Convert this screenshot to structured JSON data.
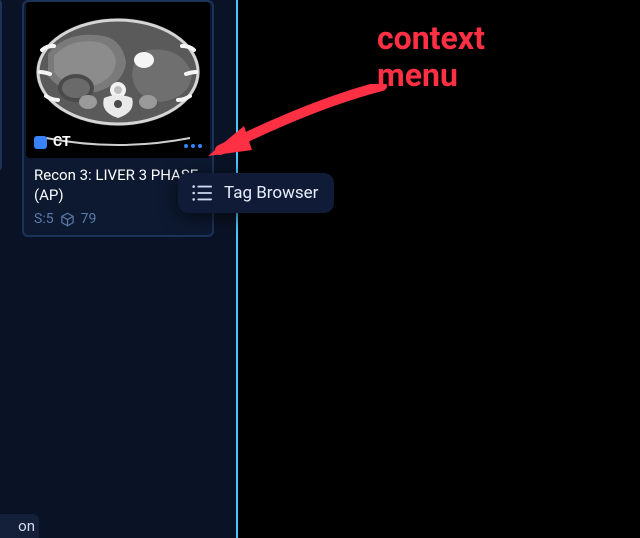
{
  "sidebar": {
    "card": {
      "modality": "CT",
      "title": "Recon 3: LIVER 3 PHASE (AP)",
      "series_label": "S:5",
      "instance_count": "79"
    }
  },
  "context_menu": {
    "items": [
      {
        "label": "Tag Browser"
      }
    ]
  },
  "annotation": {
    "line1": "context",
    "line2": "menu"
  },
  "bottom_stub": "on"
}
